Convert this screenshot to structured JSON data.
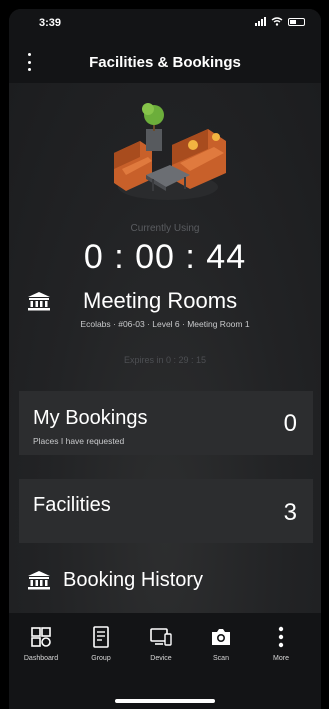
{
  "status_bar": {
    "time": "3:39"
  },
  "header": {
    "title": "Facilities & Bookings",
    "menu_icon": "kebab-menu-icon"
  },
  "current": {
    "status_label": "Currently Using",
    "timer": "0 : 00 : 44",
    "type_icon": "building-icon",
    "type": "Meeting Rooms",
    "location": "Ecolabs · #06-03 · Level 6 · Meeting Room 1",
    "expires": "Expires in 0 : 29 : 15"
  },
  "my_bookings": {
    "title": "My Bookings",
    "subtitle": "Places I have requested",
    "count": "0"
  },
  "facilities": {
    "title": "Facilities",
    "count": "3"
  },
  "history": {
    "icon": "building-icon",
    "title": "Booking History"
  },
  "tabs": [
    {
      "label": "Dashboard",
      "icon": "dashboard-icon"
    },
    {
      "label": "Group",
      "icon": "group-icon"
    },
    {
      "label": "Device",
      "icon": "device-icon"
    },
    {
      "label": "Scan",
      "icon": "camera-icon"
    },
    {
      "label": "More",
      "icon": "more-icon"
    }
  ],
  "colors": {
    "background": "#1e1f21",
    "card": "#2c2d2f",
    "bar": "#131416",
    "sofa": "#c8602a"
  }
}
